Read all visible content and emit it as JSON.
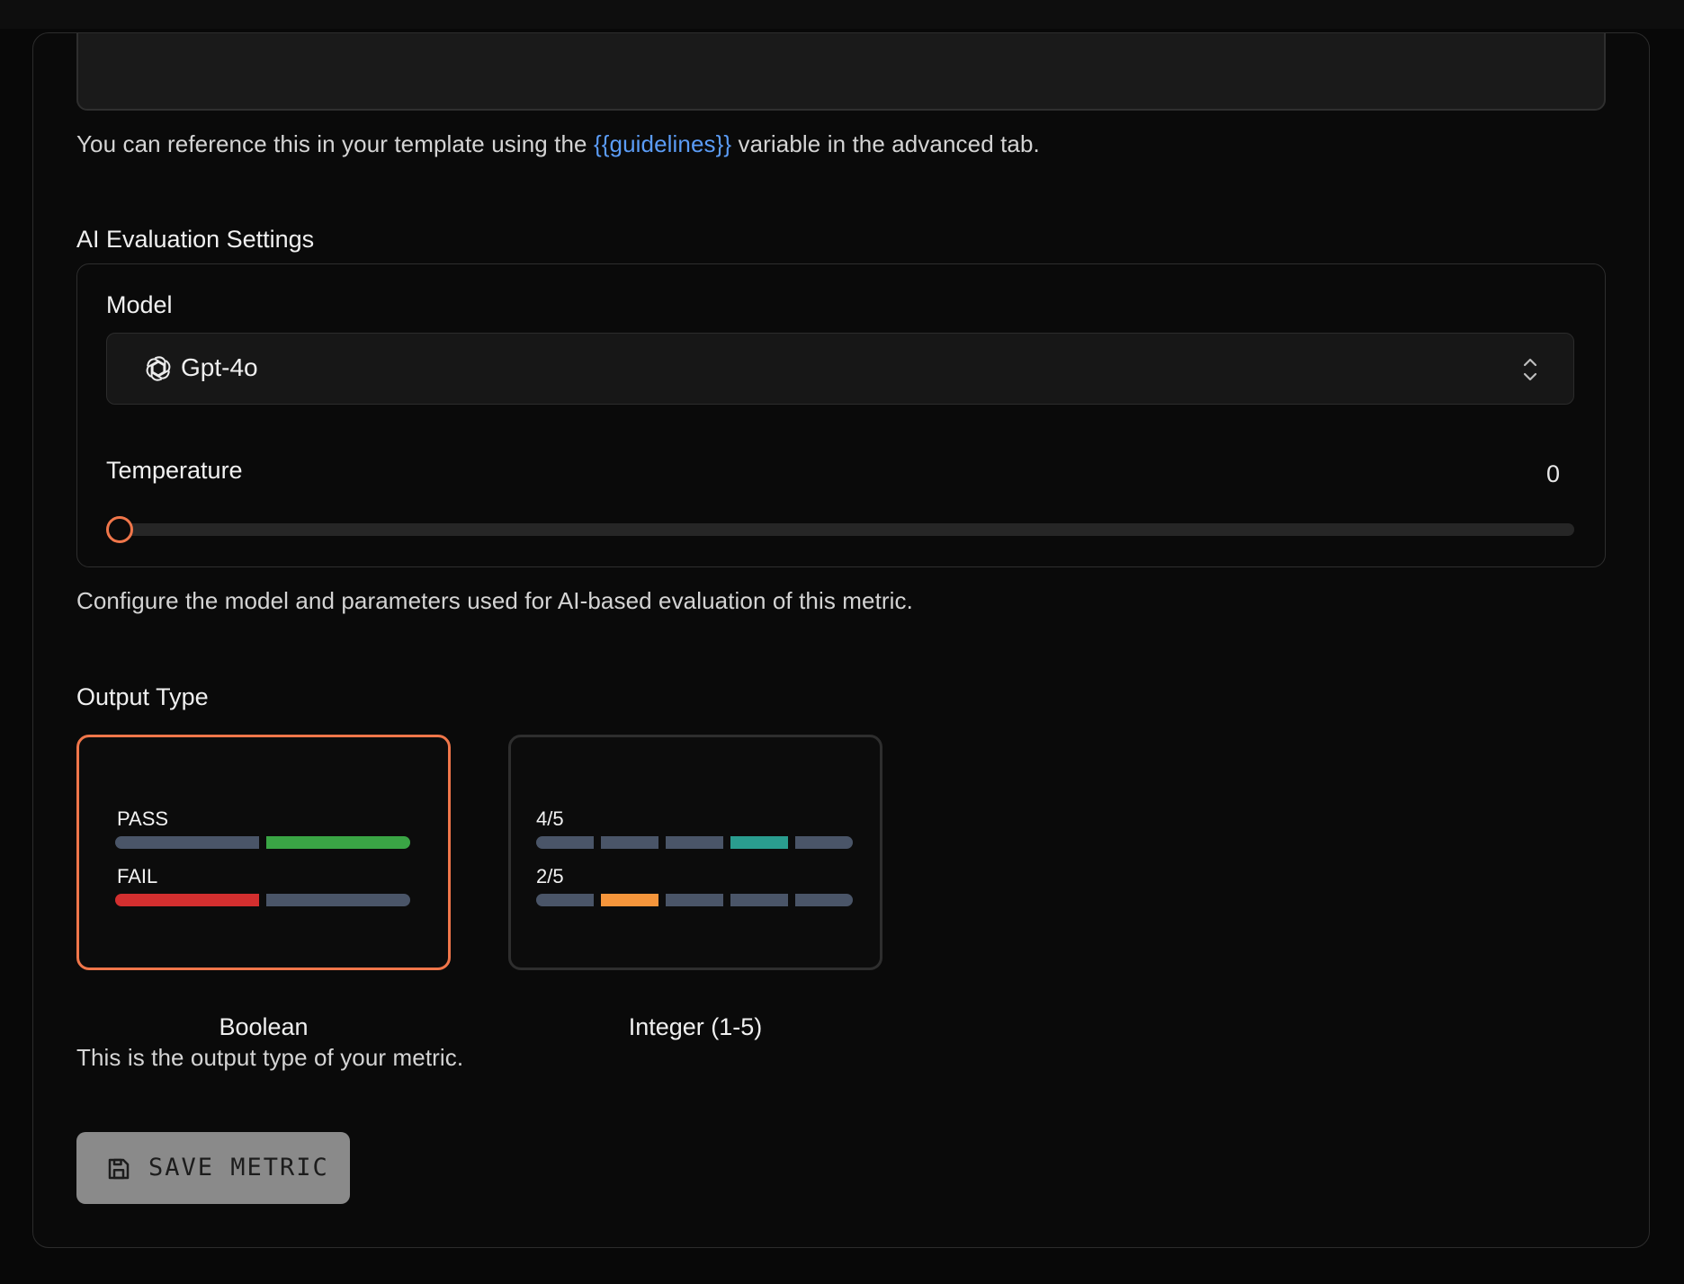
{
  "guidelines": {
    "hint_prefix": "You can reference this in your template using the",
    "hint_variable": "{{guidelines}}",
    "hint_suffix": "variable in the advanced tab."
  },
  "ai_settings": {
    "section_label": "AI Evaluation Settings",
    "model_label": "Model",
    "model_value": "Gpt-4o",
    "model_icon": "openai-icon",
    "temperature_label": "Temperature",
    "temperature_value": "0",
    "temperature_level": 0,
    "hint": "Configure the model and parameters used for AI-based evaluation of this metric."
  },
  "output_type": {
    "section_label": "Output Type",
    "selected": "Boolean",
    "options": [
      {
        "caption": "Boolean",
        "rows": [
          {
            "label": "PASS",
            "segments": [
              "#4a5568",
              "#3aa545"
            ]
          },
          {
            "label": "FAIL",
            "segments": [
              "#d32f2f",
              "#4a5568"
            ]
          }
        ]
      },
      {
        "caption": "Integer (1-5)",
        "rows": [
          {
            "label": "4/5",
            "segments": [
              "#4a5568",
              "#4a5568",
              "#4a5568",
              "#2a9d8f",
              "#4a5568"
            ]
          },
          {
            "label": "2/5",
            "segments": [
              "#4a5568",
              "#f5953b",
              "#4a5568",
              "#4a5568",
              "#4a5568"
            ]
          }
        ]
      }
    ],
    "hint": "This is the output type of your metric."
  },
  "actions": {
    "save_label": "SAVE METRIC",
    "save_icon": "floppy-disk-icon"
  },
  "colors": {
    "accent": "#f0764a",
    "link": "#5b9cf6",
    "neutral_bar": "#4a5568"
  }
}
